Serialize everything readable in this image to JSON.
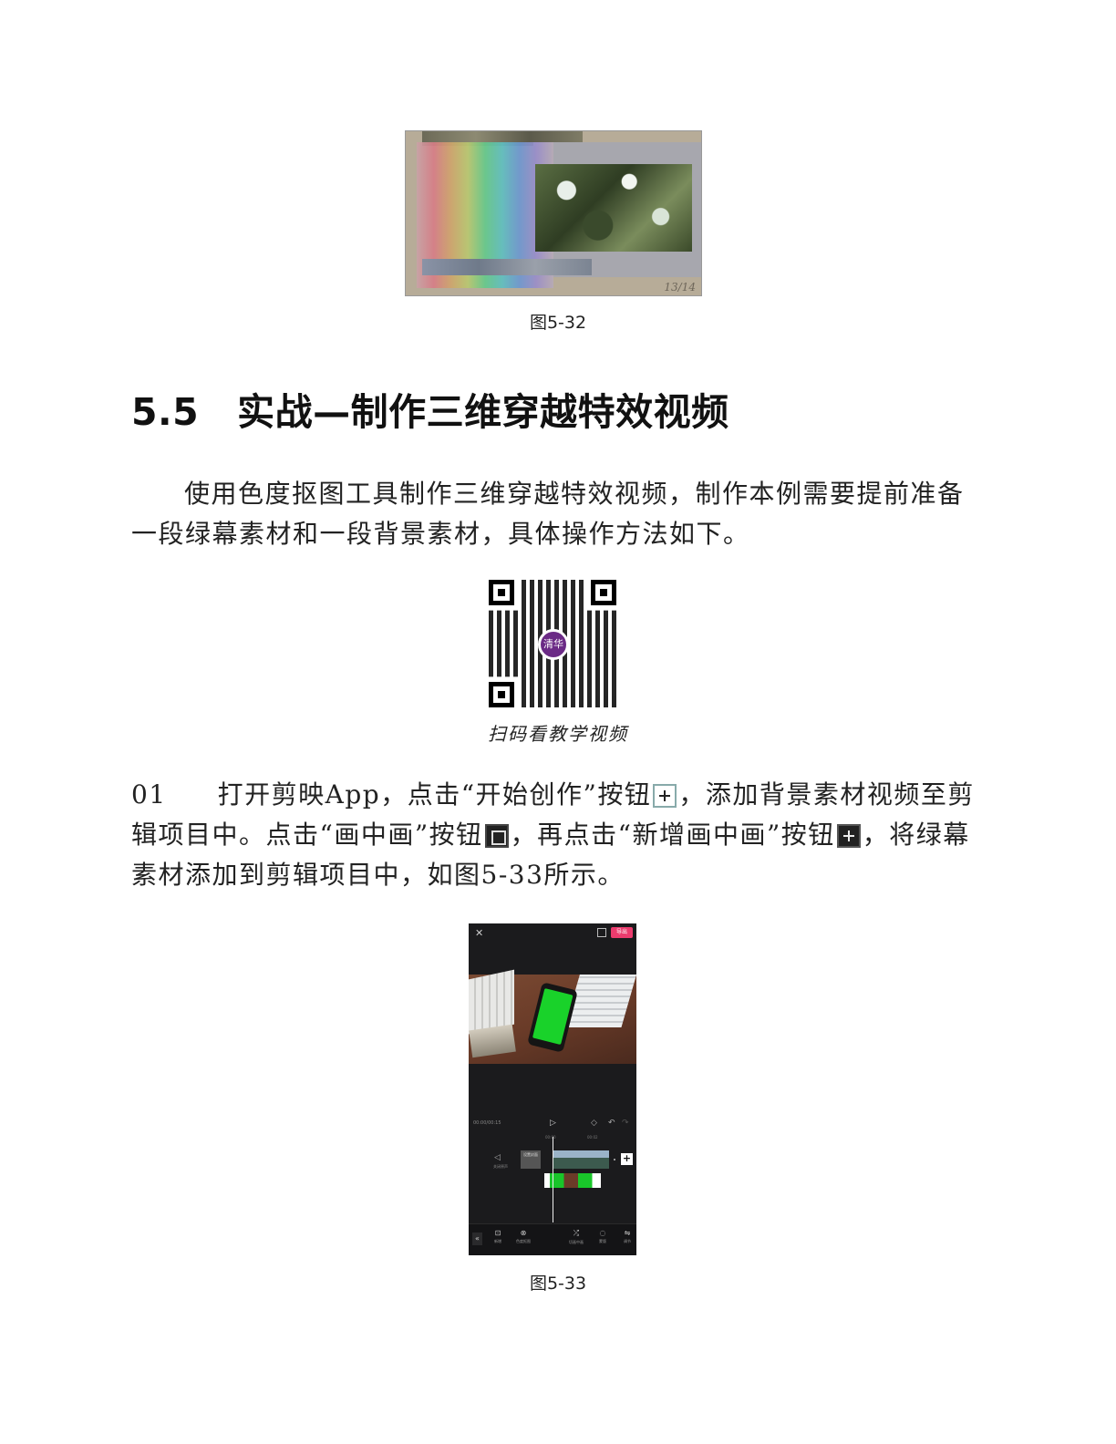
{
  "figure_532": {
    "page_number": "13/14",
    "caption": "图5-32"
  },
  "section": {
    "number": "5.5",
    "title": "实战—制作三维穿越特效视频"
  },
  "intro_paragraph": "使用色度抠图工具制作三维穿越特效视频，制作本例需要提前准备一段绿幕素材和一段背景素材，具体操作方法如下。",
  "qr": {
    "logo_text": "清华",
    "caption": "扫码看教学视频"
  },
  "step_01": {
    "number": "01",
    "text_part1": "打开剪映App，点击“开始创作”按钮",
    "text_part2": "，添加背景素材视频至剪辑项目中。点击“画中画”按钮",
    "text_part3": "，再点击“新增画中画”按钮",
    "text_part4": "，将绿幕素材添加到剪辑项目中，如图5-33所示。",
    "icons": [
      "plus-icon",
      "picture-in-picture-icon",
      "add-pip-icon"
    ]
  },
  "figure_533": {
    "caption": "图5-33",
    "app": {
      "close_symbol": "✕",
      "export_label": "导出",
      "timecode": "00:00/00:15",
      "ruler_marks": [
        "00:00",
        "00:02"
      ],
      "mute_label": "关闭原声",
      "cover_label": "设置封面",
      "add_symbol": "+",
      "collapse_symbol": "«",
      "tools": [
        {
          "icon": "⊡",
          "label": "新增"
        },
        {
          "icon": "⊗",
          "label": "色度抠图"
        },
        {
          "icon": "⤮",
          "label": "切画中画"
        },
        {
          "icon": "◌",
          "label": "蒙版"
        },
        {
          "icon": "⇋",
          "label": "调节"
        }
      ]
    }
  },
  "colors": {
    "export_button": "#ec3c6e",
    "green_screen": "#19d22a",
    "app_background": "#1b1b1d"
  }
}
